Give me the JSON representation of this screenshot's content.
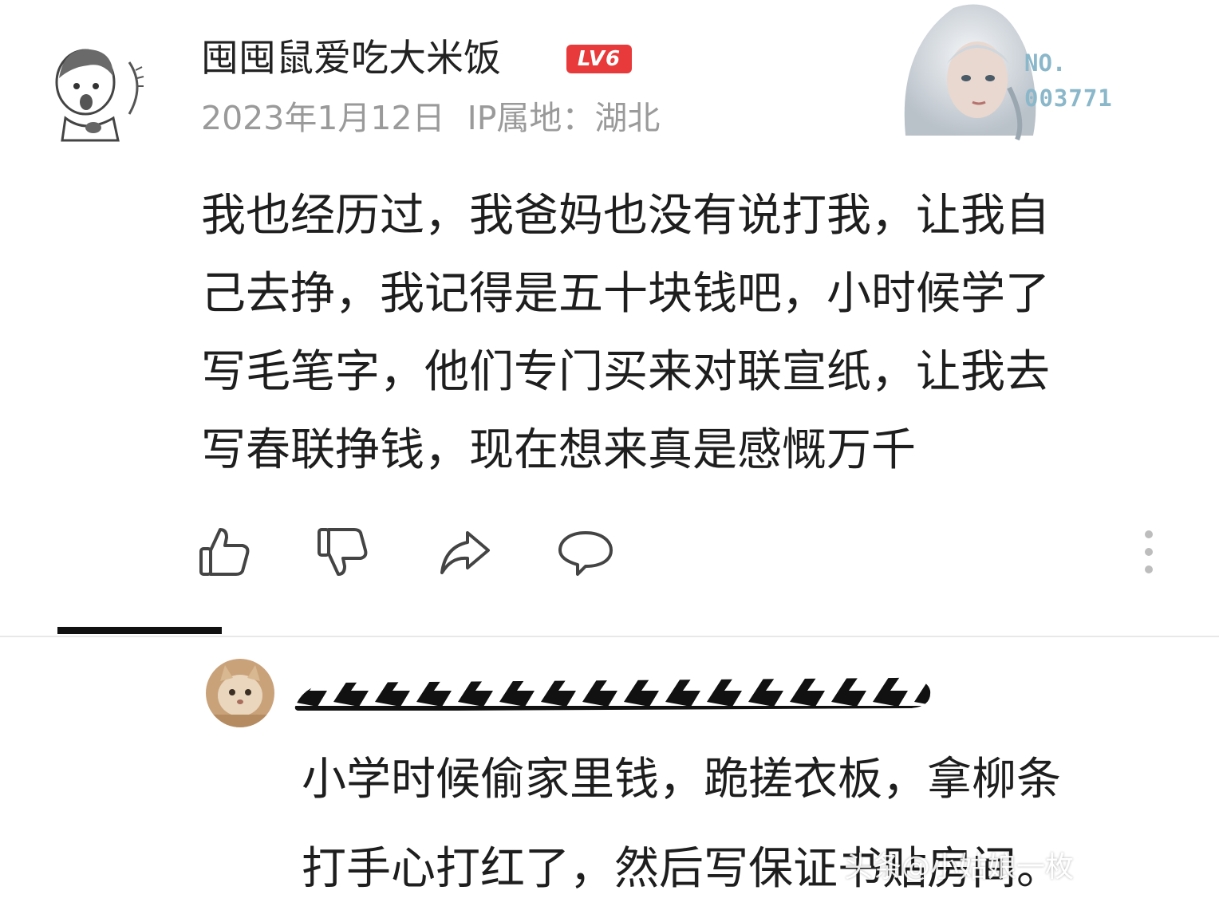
{
  "main_comment": {
    "username": "囤囤鼠爱吃大米饭",
    "level_badge": "LV6",
    "date": "2023年1月12日",
    "ip_location": "IP属地：湖北",
    "medal": {
      "no_label": "NO.",
      "number": "003771"
    },
    "content_lines": [
      "我也经历过，我爸妈也没有说打我，让我自",
      "己去挣，我记得是五十块钱吧，小时候学了",
      "写毛笔字，他们专门买来对联宣纸，让我去",
      "写春联挣钱，现在想来真是感慨万千"
    ],
    "actions": [
      "thumbs-up-icon",
      "thumbs-down-icon",
      "share-icon",
      "comment-icon",
      "more-vertical-icon"
    ]
  },
  "reply": {
    "content_lines": [
      "小学时候偷家里钱，跪搓衣板，拿柳条",
      "打手心打红了，然后写保证书贴房间。"
    ],
    "watermark": "头条@小姑娘一枚"
  },
  "colors": {
    "text": "#1e1e1e",
    "meta": "#9a9a9a",
    "badge": "#e83a3a",
    "medal_text": "#8ab7c9",
    "icon": "#444444"
  }
}
